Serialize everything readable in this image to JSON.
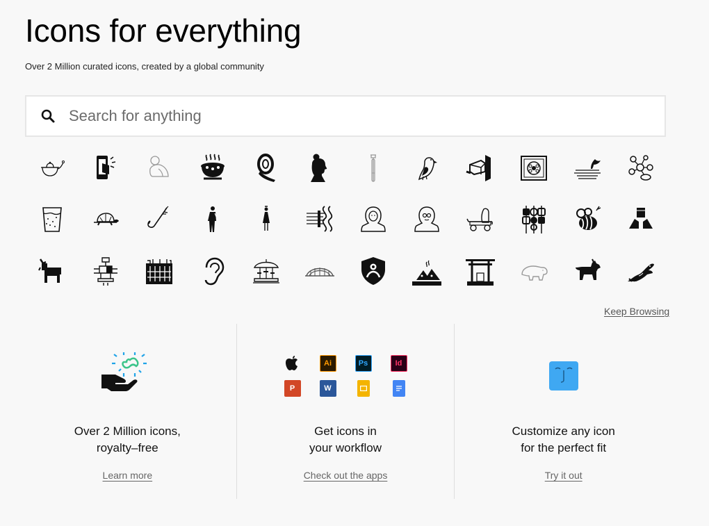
{
  "hero": {
    "title": "Icons for everything",
    "subtitle": "Over 2 Million curated icons, created by a global community"
  },
  "search": {
    "placeholder": "Search for anything",
    "icon": "search-icon"
  },
  "icon_grid": [
    "teapot-icon",
    "phone-in-box-icon",
    "praying-figure-icon",
    "steaming-pot-icon",
    "tape-roll-icon",
    "woman-profile-icon",
    "test-tube-icon",
    "puffin-icon",
    "projector-icon",
    "gift-bag-icon",
    "whale-tail-icon",
    "molecule-icon",
    "glass-of-water-icon",
    "turtle-icon",
    "fishing-hook-icon",
    "man-standing-icon",
    "woman-standing-icon",
    "dna-diagram-icon",
    "hijab-woman-icon",
    "glasses-woman-icon",
    "mobility-cart-icon",
    "skewers-icon",
    "bee-icon",
    "holding-box-icon",
    "goat-icon",
    "machine-icon",
    "cage-icon",
    "ear-icon",
    "carousel-icon",
    "arch-bridge-icon",
    "shield-user-icon",
    "campfire-tents-icon",
    "torii-gate-icon",
    "bear-icon",
    "scottie-dog-icon",
    "crocodile-icon"
  ],
  "keep_browsing": "Keep Browsing",
  "features": [
    {
      "title_line1": "Over 2 Million icons,",
      "title_line2": "royalty–free",
      "link": "Learn more",
      "graphic": "hand-with-infinity-icon"
    },
    {
      "title_line1": "Get icons in",
      "title_line2": "your workflow",
      "link": "Check out the apps",
      "apps": [
        {
          "name": "apple-icon",
          "label": "",
          "bg": "transparent",
          "fg": "#000000"
        },
        {
          "name": "illustrator-icon",
          "label": "Ai",
          "bg": "#2a1a00",
          "fg": "#ff9a00"
        },
        {
          "name": "photoshop-icon",
          "label": "Ps",
          "bg": "#001d26",
          "fg": "#31a8ff"
        },
        {
          "name": "indesign-icon",
          "label": "Id",
          "bg": "#2a0017",
          "fg": "#ff3366"
        },
        {
          "name": "powerpoint-icon",
          "label": "P",
          "bg": "#d24726",
          "fg": "#ffffff"
        },
        {
          "name": "word-icon",
          "label": "W",
          "bg": "#2b579a",
          "fg": "#ffffff"
        },
        {
          "name": "google-slides-icon",
          "label": "",
          "bg": "#f4b400",
          "fg": "#ffffff"
        },
        {
          "name": "google-docs-icon",
          "label": "",
          "bg": "#4285f4",
          "fg": "#ffffff"
        }
      ]
    },
    {
      "title_line1": "Customize any icon",
      "title_line2": "for the perfect fit",
      "link": "Try it out",
      "graphic": "customize-face-icon"
    }
  ],
  "colors": {
    "accent_green": "#3cc48a",
    "accent_blue": "#1fa3e8",
    "customize_blue": "#3fa8f2",
    "background": "#f8f8f8"
  }
}
